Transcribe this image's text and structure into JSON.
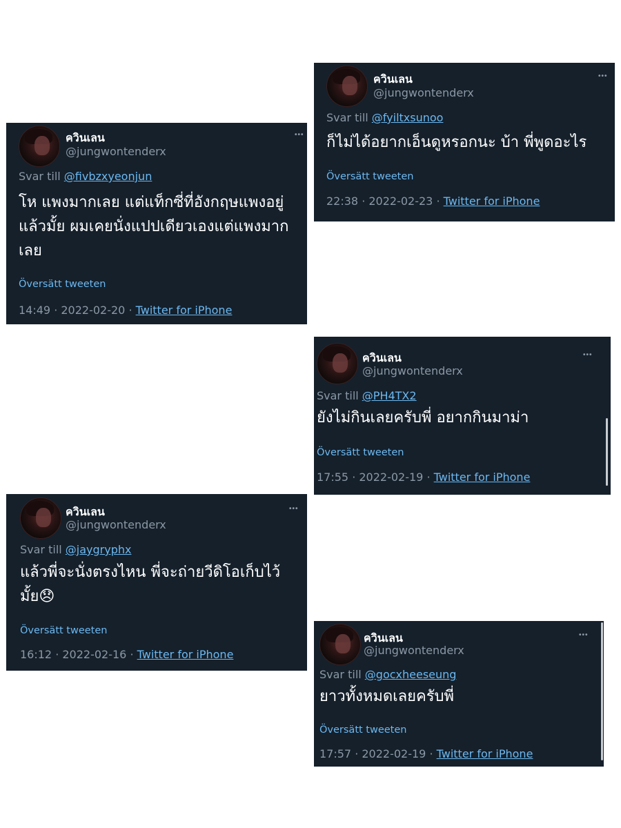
{
  "tweets": [
    {
      "display_name": "ควินเลน",
      "handle": "@jungwontenderx",
      "reply_prefix": "Svar till",
      "reply_to": "@fivbzxyeonjun",
      "text_lines": [
        "โห แพงมากเลย แต่แท็กซี่ที่อังกฤษแพงอยู่",
        "แล้วมั้ย ผมเคยนั่งแปปเดียวเองแต่แพงมาก",
        "เลย"
      ],
      "translate": "Översätt tweeten",
      "timestamp": "14:49 · 2022-02-20 · ",
      "source": "Twitter for iPhone"
    },
    {
      "display_name": "ควินเลน",
      "handle": "@jungwontenderx",
      "reply_prefix": "Svar till",
      "reply_to": "@fyiltxsunoo",
      "text_lines": [
        "ก็ไม่ได้อยากเอ็นดูหรอกนะ บ้า พี่พูดอะไร"
      ],
      "translate": "Översätt tweeten",
      "timestamp": "22:38 · 2022-02-23 · ",
      "source": "Twitter for iPhone"
    },
    {
      "display_name": "ควินเลน",
      "handle": "@jungwontenderx",
      "reply_prefix": "Svar till",
      "reply_to": "@PH4TX2",
      "text_lines": [
        "ยังไม่กินเลยครับพี่ อยากกินมาม่า"
      ],
      "translate": "Översätt tweeten",
      "timestamp": "17:55 · 2022-02-19 · ",
      "source": "Twitter for iPhone"
    },
    {
      "display_name": "ควินเลน",
      "handle": "@jungwontenderx",
      "reply_prefix": "Svar till",
      "reply_to": "@jaygryphx",
      "text_lines": [
        "แล้วพี่จะนั่งตรงไหน พี่จะถ่ายวีดิโอเก็บไว้",
        "มั้ย😞"
      ],
      "translate": "Översätt tweeten",
      "timestamp": "16:12 · 2022-02-16 · ",
      "source": "Twitter for iPhone"
    },
    {
      "display_name": "ควินเลน",
      "handle": "@jungwontenderx",
      "reply_prefix": "Svar till",
      "reply_to": "@gocxheeseung",
      "text_lines": [
        "ยาวทั้งหมดเลยครับพี่"
      ],
      "translate": "Översätt tweeten",
      "timestamp": "17:57 · 2022-02-19 · ",
      "source": "Twitter for iPhone"
    }
  ],
  "more_glyph": "•••",
  "colors": {
    "card_bg": "#15202b",
    "link": "#6cb8f0",
    "muted": "#8b98a5"
  }
}
